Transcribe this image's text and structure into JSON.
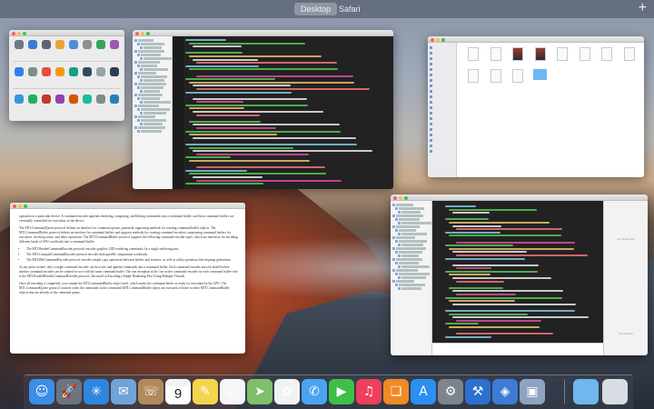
{
  "spaces": {
    "desktop_label": "Desktop",
    "safari_label": "Safari",
    "add_label": "+"
  },
  "windows": {
    "prefs": {
      "title": ""
    },
    "xcode_top": {
      "title": ""
    },
    "finder": {
      "title": ""
    },
    "document": {
      "paragraphs": [
        "operation in a particular device. A command encoder appends rendering, computing, and blitting commands onto a command buffer, and those command buffers are eventually committed for execution on the device.",
        "The MTLCommandQueue protocol defines an interface for command queues, primarily supporting methods for creating command buffer objects. The MTLCommandBuffer protocol defines an interface for command buffers and supports methods for creating command encoders, enqueueing command buffers for execution, checking status, and other operations. The MTLCommandBuffer protocol supports the following command encoder types, which are interfaces for encoding different kinds of GPU workloads into a command buffer:"
      ],
      "bullets": [
        "The MTLRenderCommandEncoder protocol encodes graphics (3D) rendering commands for a single rendering pass.",
        "The MTLComputeCommandEncoder protocol encodes data-parallel computation workloads.",
        "The MTLBlitCommandEncoder protocol encodes simple copy operations between buffers and textures, as well as utility operations like mipmap generation."
      ],
      "paragraphs2": [
        "At any point in time, only a single command encoder can be active and append commands into a command buffer. Each command encoder must be ended before another command encoder can be created for use with the same command buffer. The one exception to the 'one active command encoder for each command buffer' rule is the MTLParallelRenderCommandEncoder protocol, discussed in Encoding a Single Rendering Pass Using Multiple Threads.",
        "Once all encoding is completed, you commit the MTLCommandBuffer object itself, which marks the command buffer as ready for execution by the GPU. The MTLCommandQueue protocol controls when the commands in the committed MTLCommandBuffer object are executed, relative to other MTLCommandBuffer objects that are already in the command queue."
      ],
      "footer": ""
    },
    "xcode_bottom": {
      "inspector_no_quick_help": "No Quick Help",
      "inspector_no_matches": "No Matches"
    }
  },
  "dock": {
    "apps": [
      {
        "name": "Finder",
        "color": "#3a8ee6",
        "glyph": "☺"
      },
      {
        "name": "Launchpad",
        "color": "#6c7480",
        "glyph": "🚀"
      },
      {
        "name": "Safari",
        "color": "#2f86e0",
        "glyph": "✳"
      },
      {
        "name": "Mail",
        "color": "#6fa4d8",
        "glyph": "✉"
      },
      {
        "name": "Contacts",
        "color": "#b08a5a",
        "glyph": "☏"
      },
      {
        "name": "Calendar",
        "color": "#ffffff",
        "glyph": ""
      },
      {
        "name": "Notes",
        "color": "#f5d44e",
        "glyph": "✎"
      },
      {
        "name": "Reminders",
        "color": "#f6f6f6",
        "glyph": "☑"
      },
      {
        "name": "Maps",
        "color": "#7fbf6a",
        "glyph": "➤"
      },
      {
        "name": "Photos",
        "color": "#f2f2f2",
        "glyph": "✿"
      },
      {
        "name": "Messages",
        "color": "#4aa3f0",
        "glyph": "✆"
      },
      {
        "name": "FaceTime",
        "color": "#3fbf4a",
        "glyph": "▶"
      },
      {
        "name": "iTunes",
        "color": "#ee3f5c",
        "glyph": "♫"
      },
      {
        "name": "iBooks",
        "color": "#f08a24",
        "glyph": "❏"
      },
      {
        "name": "App Store",
        "color": "#2d8ff0",
        "glyph": "A"
      },
      {
        "name": "System Preferences",
        "color": "#7d848e",
        "glyph": "⚙"
      },
      {
        "name": "Xcode",
        "color": "#2c6fd1",
        "glyph": "⚒"
      },
      {
        "name": "Instruments",
        "color": "#3e7ad6",
        "glyph": "◈"
      },
      {
        "name": "Preview",
        "color": "#8da3c0",
        "glyph": "▣"
      }
    ],
    "calendar": {
      "month": "",
      "day": "9"
    },
    "downloads": {
      "color": "#6fb7ee"
    },
    "trash": {
      "color": "#d8dde3"
    }
  }
}
